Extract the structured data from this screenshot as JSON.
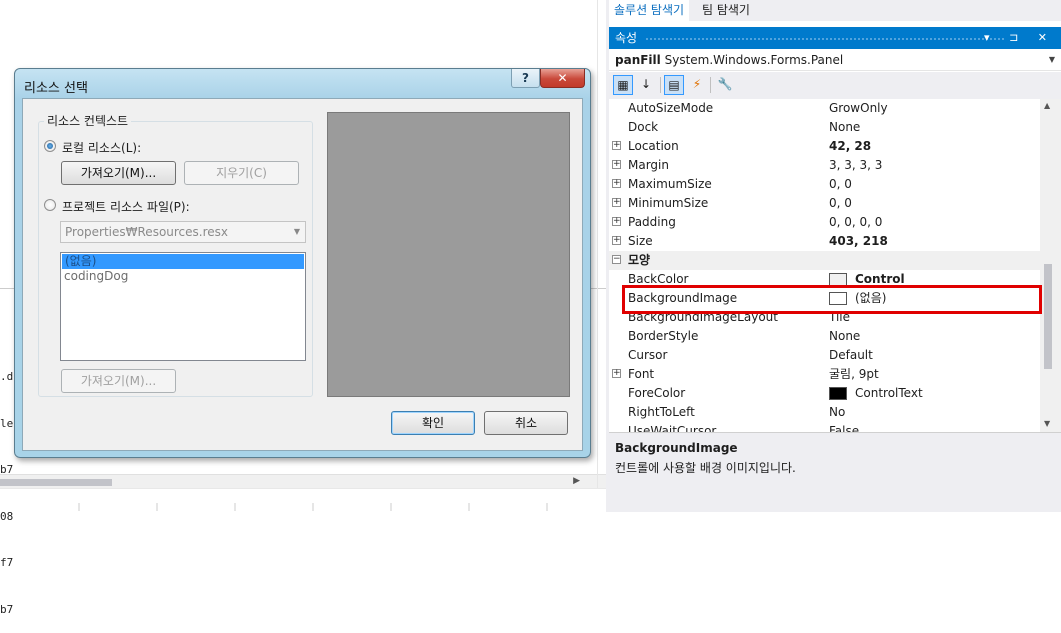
{
  "editor": {
    "code_fragments": [
      ".d",
      "le",
      "b7",
      "08",
      "f7",
      "b7"
    ]
  },
  "dialog": {
    "title": "리소스 선택",
    "help_glyph": "?",
    "close_glyph": "✕",
    "group_label": "리소스 컨텍스트",
    "local_resource_label": "로컬 리소스(L):",
    "import_button": "가져오기(M)...",
    "clear_button": "지우기(C)",
    "project_resource_label": "프로젝트 리소스 파일(P):",
    "resource_file": "Properties₩Resources.resx",
    "list_items": [
      "(없음)",
      "codingDog"
    ],
    "import_button_2": "가져오기(M)...",
    "ok_button": "확인",
    "cancel_button": "취소"
  },
  "tabs": [
    "솔루션 탐색기",
    "팀 탐색기"
  ],
  "properties": {
    "header_title": "속성",
    "header_icons": "▾ ⊐ ✕",
    "object_name": "panFill",
    "object_type": "System.Windows.Forms.Panel",
    "rows": [
      {
        "name": "AutoSizeMode",
        "value": "GrowOnly"
      },
      {
        "name": "Dock",
        "value": "None"
      },
      {
        "name": "Location",
        "value": "42, 28"
      },
      {
        "name": "Margin",
        "value": "3, 3, 3, 3"
      },
      {
        "name": "MaximumSize",
        "value": "0, 0"
      },
      {
        "name": "MinimumSize",
        "value": "0, 0"
      },
      {
        "name": "Padding",
        "value": "0, 0, 0, 0"
      },
      {
        "name": "Size",
        "value": "403, 218"
      },
      {
        "name": "모양",
        "value": ""
      },
      {
        "name": "BackColor",
        "value": "Control"
      },
      {
        "name": "BackgroundImage",
        "value": "(없음)"
      },
      {
        "name": "BackgroundImageLayout",
        "value": "Tile"
      },
      {
        "name": "BorderStyle",
        "value": "None"
      },
      {
        "name": "Cursor",
        "value": "Default"
      },
      {
        "name": "Font",
        "value": "굴림, 9pt"
      },
      {
        "name": "ForeColor",
        "value": "ControlText"
      },
      {
        "name": "RightToLeft",
        "value": "No"
      },
      {
        "name": "UseWaitCursor",
        "value": "False"
      }
    ],
    "description_title": "BackgroundImage",
    "description_text": "컨트롤에 사용할 배경 이미지입니다."
  },
  "colors": {
    "accent": "#007acc",
    "highlight": "#e00000",
    "selection": "#3399ff"
  }
}
